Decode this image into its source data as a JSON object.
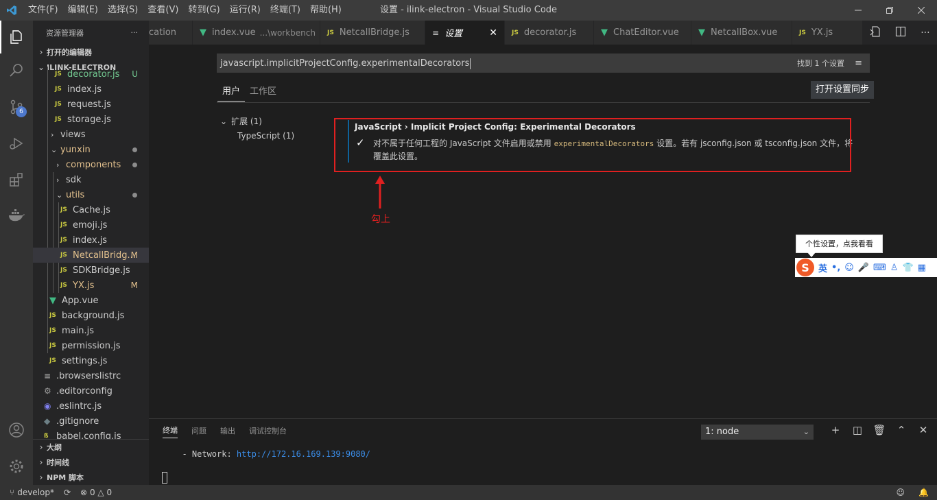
{
  "titlebar": {
    "menus": [
      "文件(F)",
      "编辑(E)",
      "选择(S)",
      "查看(V)",
      "转到(G)",
      "运行(R)",
      "终端(T)",
      "帮助(H)"
    ],
    "title": "设置 - ilink-electron - Visual Studio Code"
  },
  "activitybar": {
    "scm_badge": "6"
  },
  "sidebar": {
    "header": "资源管理器",
    "more": "···",
    "open_editors": "打开的编辑器",
    "project": "ILINK-ELECTRON",
    "files": [
      {
        "label": "decorator.js",
        "status": "U"
      },
      {
        "label": "index.js"
      },
      {
        "label": "request.js"
      },
      {
        "label": "storage.js"
      },
      {
        "label": "views"
      },
      {
        "label": "yunxin"
      },
      {
        "label": "components"
      },
      {
        "label": "sdk"
      },
      {
        "label": "utils"
      },
      {
        "label": "Cache.js"
      },
      {
        "label": "emoji.js"
      },
      {
        "label": "index.js"
      },
      {
        "label": "NetcallBridg...",
        "status": "M"
      },
      {
        "label": "SDKBridge.js"
      },
      {
        "label": "YX.js",
        "status": "M"
      },
      {
        "label": "App.vue"
      },
      {
        "label": "background.js"
      },
      {
        "label": "main.js"
      },
      {
        "label": "permission.js"
      },
      {
        "label": "settings.js"
      },
      {
        "label": ".browserslistrc"
      },
      {
        "label": ".editorconfig"
      },
      {
        "label": ".eslintrc.js"
      },
      {
        "label": ".gitignore"
      },
      {
        "label": "babel.config.js"
      }
    ],
    "outline": "大纲",
    "timeline": "时间线",
    "npm": "NPM 脚本"
  },
  "tabs": [
    {
      "label": "cation"
    },
    {
      "label": "index.vue",
      "desc": "...\\workbench"
    },
    {
      "label": "NetcallBridge.js"
    },
    {
      "label": "设置"
    },
    {
      "label": "decorator.js"
    },
    {
      "label": "ChatEditor.vue"
    },
    {
      "label": "NetcallBox.vue"
    },
    {
      "label": "YX.js"
    }
  ],
  "settings": {
    "search_value": "javascript.implicitProjectConfig.experimentalDecorators",
    "found": "找到 1 个设置",
    "scope_user": "用户",
    "scope_workspace": "工作区",
    "sync_button": "打开设置同步",
    "toc_ext": "扩展 (1)",
    "toc_ts": "TypeScript (1)",
    "setting_title": "JavaScript › Implicit Project Config: Experimental Decorators",
    "setting_desc_1": "对不属于任何工程的 JavaScript 文件启用或禁用",
    "setting_code": "experimentalDecorators",
    "setting_desc_2": "设置。若有 jsconfig.json 或 tsconfig.json 文件，将覆盖此设置。",
    "checked": true
  },
  "annotation": "勾上",
  "annotation_color": "#e02020",
  "ime": {
    "tip": "个性设置，点我看看",
    "logo": "S",
    "mode": "英"
  },
  "panel": {
    "tabs": [
      "终端",
      "问题",
      "输出",
      "调试控制台"
    ],
    "terminal_select": "1: node",
    "output_prefix": "  - Network: ",
    "output_url": "http://172.16.169.139:9080/"
  },
  "statusbar": {
    "branch": "develop*",
    "errors": "0",
    "warnings": "0"
  }
}
